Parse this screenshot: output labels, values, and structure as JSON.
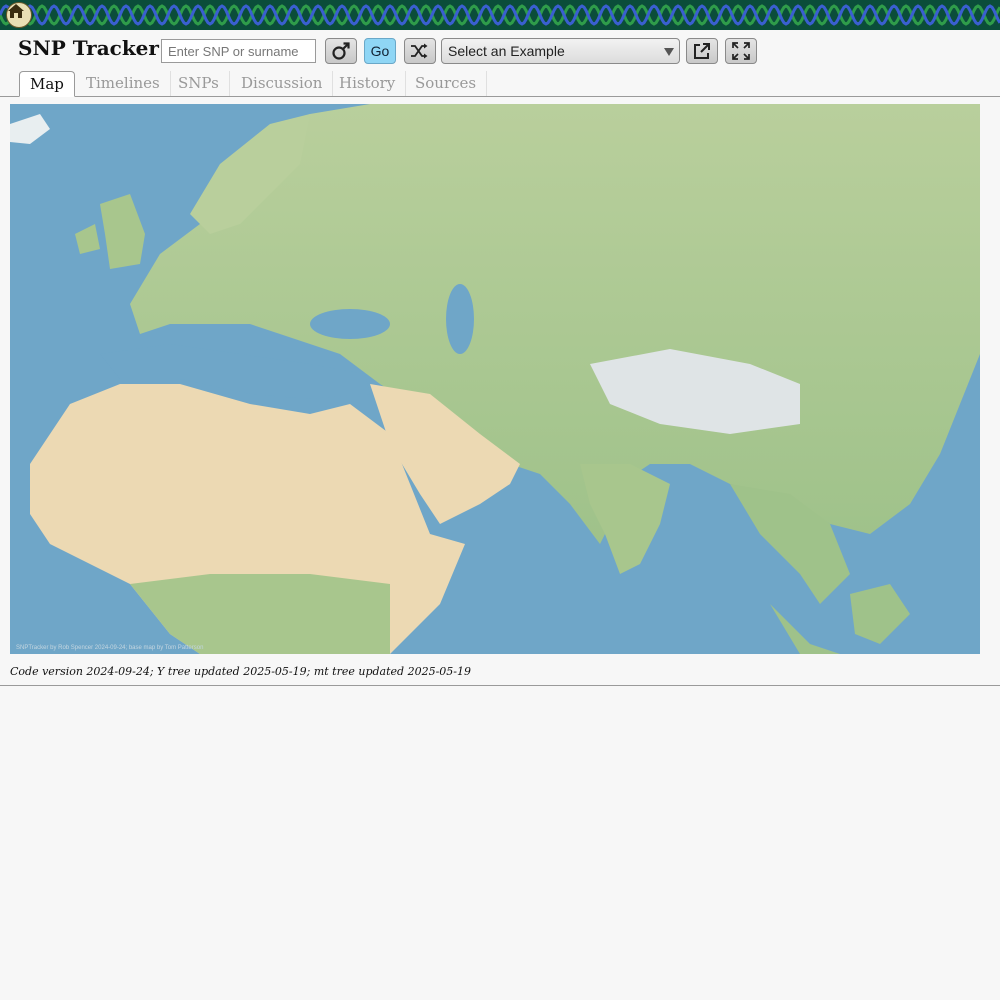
{
  "app": {
    "title": "SNP Tracker"
  },
  "toolbar": {
    "search_placeholder": "Enter SNP or surname",
    "search_value": "",
    "go_label": "Go",
    "example_select_value": "Select an Example"
  },
  "icons": {
    "home": "home-icon",
    "sex": "male-symbol-icon",
    "random": "shuffle-icon",
    "open_new": "external-link-icon",
    "fullscreen": "fullscreen-icon"
  },
  "tabs": [
    {
      "label": "Map",
      "active": true
    },
    {
      "label": "Timelines",
      "active": false
    },
    {
      "label": "SNPs",
      "active": false
    },
    {
      "label": "Discussion",
      "active": false
    },
    {
      "label": "History",
      "active": false
    },
    {
      "label": "Sources",
      "active": false
    }
  ],
  "map": {
    "attribution": "SNPTracker by Rob Spencer 2024-09-24; base map by Tom Patterson"
  },
  "footer": {
    "version_text": "Code version 2024-09-24; Y tree updated 2025-05-19; mt tree updated 2025-05-19"
  },
  "colors": {
    "banner_bg": "#0b4d3a",
    "go_button": "#8fd6f5",
    "ocean": "#6fa6c8",
    "land": "#a9c98f",
    "desert": "#ecd9b3"
  }
}
